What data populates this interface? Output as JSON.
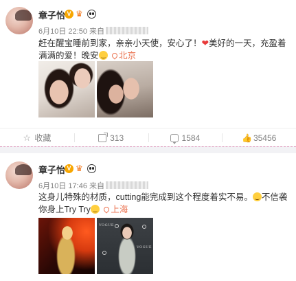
{
  "posts": [
    {
      "author": "章子怡",
      "vip_badge": "V",
      "time": "6月10日 22:50",
      "source_prefix": "来自",
      "text_a": "赶在醒宝睡前到家，亲亲小天使，安心了！",
      "text_b": "美好的一天，充盈着满满的爱！晚安",
      "location": "北京",
      "images": [
        "photo-1",
        "photo-2"
      ],
      "actions": {
        "favorite": "收藏",
        "share": "313",
        "comment": "1584",
        "like": "35456"
      }
    },
    {
      "author": "章子怡",
      "vip_badge": "V",
      "time": "6月10日 17:46",
      "source_prefix": "来自",
      "text_a": "这身儿特殊的材质，cutting能完成到这个程度着实不易。",
      "text_b": "不信袭你身上Try Try",
      "location": "上海",
      "images": [
        "photo-1",
        "photo-2"
      ]
    }
  ],
  "colors": {
    "orange_accent": "#eb7350",
    "text_gray": "#808080",
    "badge_gold": "#f7a600"
  },
  "icons": {
    "favorite": "star-icon",
    "share": "share-icon",
    "comment": "comment-icon",
    "like": "thumbs-up-icon"
  }
}
